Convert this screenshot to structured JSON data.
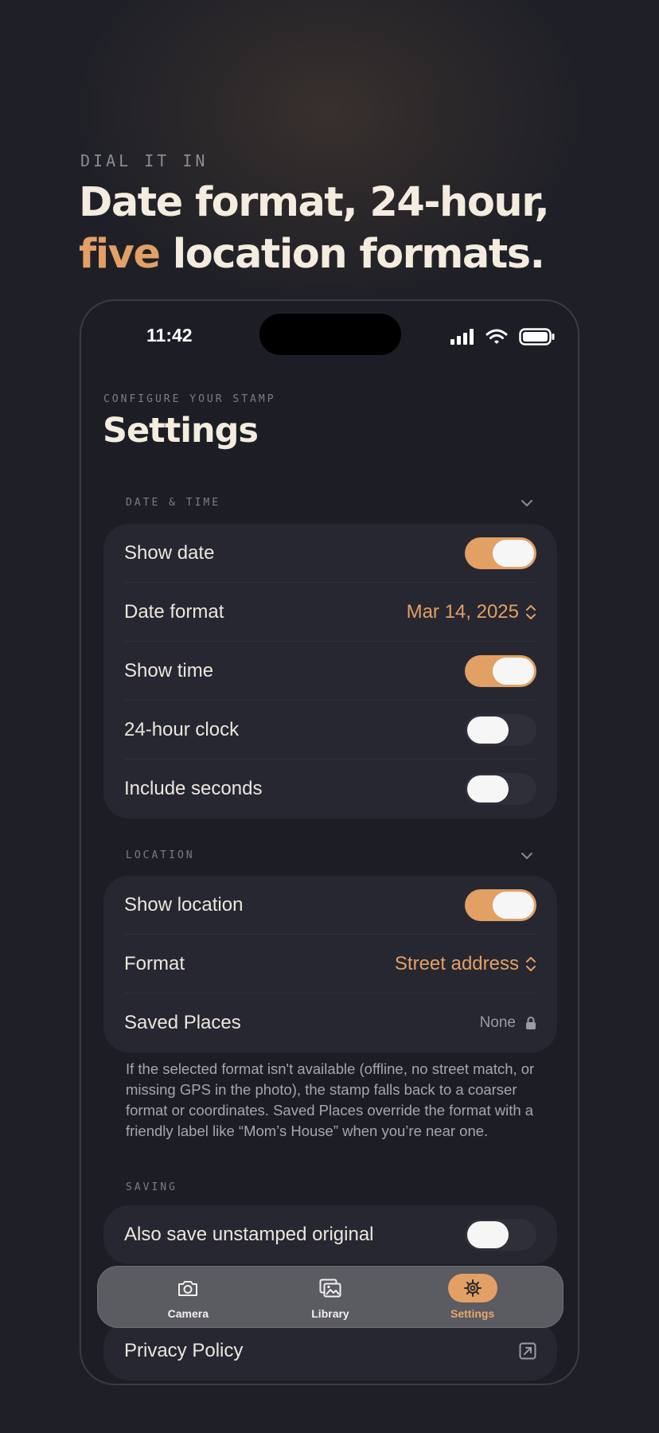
{
  "page": {
    "eyebrow": "DIAL IT IN",
    "headline_line1": "Date format, 24-hour,",
    "headline_accent": "five",
    "headline_line2_rest": " location formats."
  },
  "status_bar": {
    "time": "11:42"
  },
  "screen": {
    "eyebrow": "CONFIGURE YOUR STAMP",
    "title": "Settings"
  },
  "sections": {
    "date_time": {
      "header": "DATE & TIME",
      "show_date": {
        "label": "Show date",
        "on": true
      },
      "date_format": {
        "label": "Date format",
        "value": "Mar 14, 2025"
      },
      "show_time": {
        "label": "Show time",
        "on": true
      },
      "clock_24h": {
        "label": "24-hour clock",
        "on": false
      },
      "include_seconds": {
        "label": "Include seconds",
        "on": false
      }
    },
    "location": {
      "header": "LOCATION",
      "show_location": {
        "label": "Show location",
        "on": true
      },
      "format": {
        "label": "Format",
        "value": "Street address"
      },
      "saved_places": {
        "label": "Saved Places",
        "value": "None"
      },
      "footnote": "If the selected format isn't available (offline, no street match, or missing GPS in the photo), the stamp falls back to a coarser format or coordinates. Saved Places override the format with a friendly label like “Mom’s House” when you’re near one."
    },
    "saving": {
      "header": "SAVING",
      "save_original": {
        "label": "Also save unstamped original",
        "on": false
      }
    },
    "privacy": {
      "label": "Privacy Policy"
    }
  },
  "tabbar": {
    "tabs": [
      {
        "label": "Camera",
        "icon": "camera-icon",
        "active": false
      },
      {
        "label": "Library",
        "icon": "photo-library-icon",
        "active": false
      },
      {
        "label": "Settings",
        "icon": "gear-icon",
        "active": true
      }
    ]
  },
  "colors": {
    "accent": "#e2a065",
    "background": "#1f2027",
    "card": "#262731"
  }
}
